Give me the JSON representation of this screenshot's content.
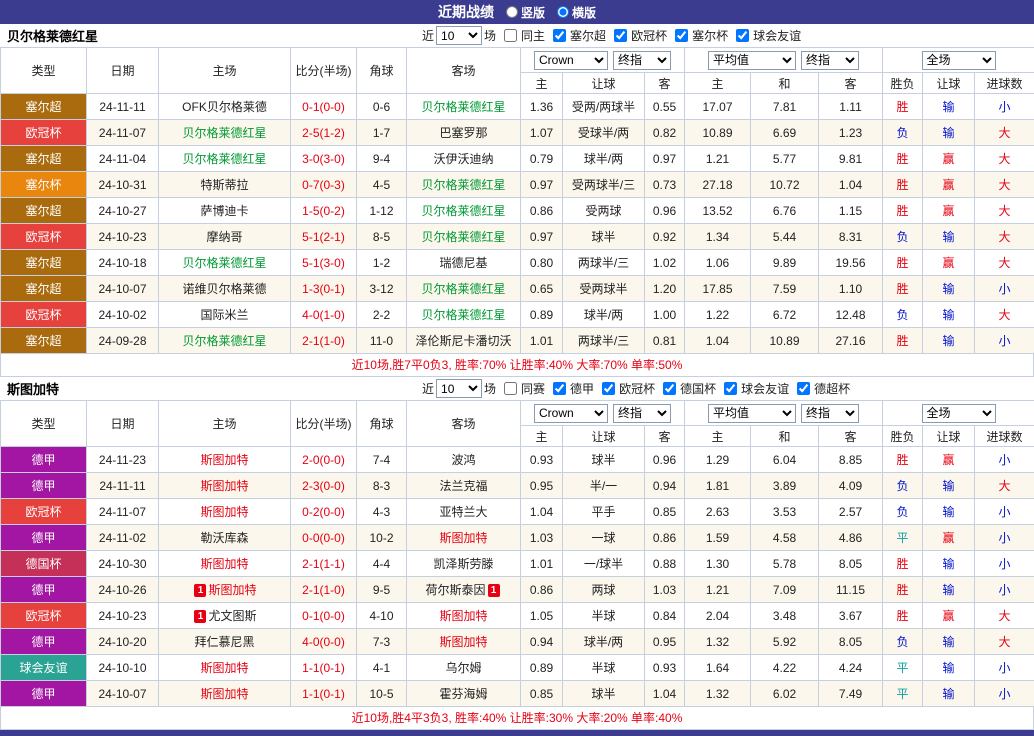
{
  "header": {
    "title": "近期战绩",
    "modes": [
      {
        "label": "竖版",
        "checked": false
      },
      {
        "label": "横版",
        "checked": true
      }
    ]
  },
  "colors": {
    "topbar_bg": "#3b3b8f",
    "league": {
      "塞尔超": "#aa6b0e",
      "欧冠杯": "#e6413d",
      "塞尔杯": "#e8860e",
      "德甲": "#a316a3",
      "德国杯": "#c43057",
      "球会友谊": "#2aa394"
    },
    "team": {
      "green": "#009933",
      "red": "#e60012",
      "black": "#222222"
    },
    "result": {
      "red": "#e60012",
      "blue": "#0010cc",
      "teal": "#0d9f9f"
    },
    "score": "#e60012",
    "summary": "#e60012"
  },
  "sections": [
    {
      "team": "贝尔格莱德红星",
      "filter": {
        "near_label": "近",
        "count": "10",
        "games_label": "场",
        "same_label": "同主",
        "same_checked": false,
        "leagues": [
          "塞尔超",
          "欧冠杯",
          "塞尔杯",
          "球会友谊"
        ]
      },
      "table_header": {
        "static": [
          "类型",
          "日期",
          "主场",
          "比分(半场)",
          "角球",
          "客场"
        ],
        "bookmaker": "Crown",
        "final_odds": "终指",
        "average": "平均值",
        "final_odds2": "终指",
        "fulltime": "全场",
        "sub": [
          "主",
          "让球",
          "客",
          "主",
          "和",
          "客",
          "胜负",
          "让球",
          "进球数"
        ]
      },
      "rows": [
        {
          "league": "塞尔超",
          "date": "24-11-11",
          "home": "OFK贝尔格莱德",
          "home_color": "black",
          "home_card": "",
          "score": "0-1(0-0)",
          "corner": "0-6",
          "away": "贝尔格莱德红星",
          "away_color": "green",
          "away_card": "",
          "odds": [
            "1.36",
            "受两/两球半",
            "0.55"
          ],
          "avg": [
            "17.07",
            "7.81",
            "1.11"
          ],
          "results": [
            [
              "胜",
              "red"
            ],
            [
              "输",
              "blue"
            ],
            [
              "小",
              "blue"
            ]
          ]
        },
        {
          "league": "欧冠杯",
          "date": "24-11-07",
          "home": "贝尔格莱德红星",
          "home_color": "green",
          "home_card": "",
          "score": "2-5(1-2)",
          "corner": "1-7",
          "away": "巴塞罗那",
          "away_color": "black",
          "away_card": "",
          "odds": [
            "1.07",
            "受球半/两",
            "0.82"
          ],
          "avg": [
            "10.89",
            "6.69",
            "1.23"
          ],
          "results": [
            [
              "负",
              "blue"
            ],
            [
              "输",
              "blue"
            ],
            [
              "大",
              "red"
            ]
          ]
        },
        {
          "league": "塞尔超",
          "date": "24-11-04",
          "home": "贝尔格莱德红星",
          "home_color": "green",
          "home_card": "",
          "score": "3-0(3-0)",
          "corner": "9-4",
          "away": "沃伊沃迪纳",
          "away_color": "black",
          "away_card": "",
          "odds": [
            "0.79",
            "球半/两",
            "0.97"
          ],
          "avg": [
            "1.21",
            "5.77",
            "9.81"
          ],
          "results": [
            [
              "胜",
              "red"
            ],
            [
              "赢",
              "red"
            ],
            [
              "大",
              "red"
            ]
          ]
        },
        {
          "league": "塞尔杯",
          "date": "24-10-31",
          "home": "特斯蒂拉",
          "home_color": "black",
          "home_card": "",
          "score": "0-7(0-3)",
          "corner": "4-5",
          "away": "贝尔格莱德红星",
          "away_color": "green",
          "away_card": "",
          "odds": [
            "0.97",
            "受两球半/三",
            "0.73"
          ],
          "avg": [
            "27.18",
            "10.72",
            "1.04"
          ],
          "results": [
            [
              "胜",
              "red"
            ],
            [
              "赢",
              "red"
            ],
            [
              "大",
              "red"
            ]
          ]
        },
        {
          "league": "塞尔超",
          "date": "24-10-27",
          "home": "萨博迪卡",
          "home_color": "black",
          "home_card": "",
          "score": "1-5(0-2)",
          "corner": "1-12",
          "away": "贝尔格莱德红星",
          "away_color": "green",
          "away_card": "",
          "odds": [
            "0.86",
            "受两球",
            "0.96"
          ],
          "avg": [
            "13.52",
            "6.76",
            "1.15"
          ],
          "results": [
            [
              "胜",
              "red"
            ],
            [
              "赢",
              "red"
            ],
            [
              "大",
              "red"
            ]
          ]
        },
        {
          "league": "欧冠杯",
          "date": "24-10-23",
          "home": "摩纳哥",
          "home_color": "black",
          "home_card": "",
          "score": "5-1(2-1)",
          "corner": "8-5",
          "away": "贝尔格莱德红星",
          "away_color": "green",
          "away_card": "",
          "odds": [
            "0.97",
            "球半",
            "0.92"
          ],
          "avg": [
            "1.34",
            "5.44",
            "8.31"
          ],
          "results": [
            [
              "负",
              "blue"
            ],
            [
              "输",
              "blue"
            ],
            [
              "大",
              "red"
            ]
          ]
        },
        {
          "league": "塞尔超",
          "date": "24-10-18",
          "home": "贝尔格莱德红星",
          "home_color": "green",
          "home_card": "",
          "score": "5-1(3-0)",
          "corner": "1-2",
          "away": "瑞德尼基",
          "away_color": "black",
          "away_card": "",
          "odds": [
            "0.80",
            "两球半/三",
            "1.02"
          ],
          "avg": [
            "1.06",
            "9.89",
            "19.56"
          ],
          "results": [
            [
              "胜",
              "red"
            ],
            [
              "赢",
              "red"
            ],
            [
              "大",
              "red"
            ]
          ]
        },
        {
          "league": "塞尔超",
          "date": "24-10-07",
          "home": "诺维贝尔格莱德",
          "home_color": "black",
          "home_card": "",
          "score": "1-3(0-1)",
          "corner": "3-12",
          "away": "贝尔格莱德红星",
          "away_color": "green",
          "away_card": "",
          "odds": [
            "0.65",
            "受两球半",
            "1.20"
          ],
          "avg": [
            "17.85",
            "7.59",
            "1.10"
          ],
          "results": [
            [
              "胜",
              "red"
            ],
            [
              "输",
              "blue"
            ],
            [
              "小",
              "blue"
            ]
          ]
        },
        {
          "league": "欧冠杯",
          "date": "24-10-02",
          "home": "国际米兰",
          "home_color": "black",
          "home_card": "",
          "score": "4-0(1-0)",
          "corner": "2-2",
          "away": "贝尔格莱德红星",
          "away_color": "green",
          "away_card": "",
          "odds": [
            "0.89",
            "球半/两",
            "1.00"
          ],
          "avg": [
            "1.22",
            "6.72",
            "12.48"
          ],
          "results": [
            [
              "负",
              "blue"
            ],
            [
              "输",
              "blue"
            ],
            [
              "大",
              "red"
            ]
          ]
        },
        {
          "league": "塞尔超",
          "date": "24-09-28",
          "home": "贝尔格莱德红星",
          "home_color": "green",
          "home_card": "",
          "score": "2-1(1-0)",
          "corner": "11-0",
          "away": "泽伦斯尼卡潘切沃",
          "away_color": "black",
          "away_card": "",
          "odds": [
            "1.01",
            "两球半/三",
            "0.81"
          ],
          "avg": [
            "1.04",
            "10.89",
            "27.16"
          ],
          "results": [
            [
              "胜",
              "red"
            ],
            [
              "输",
              "blue"
            ],
            [
              "小",
              "blue"
            ]
          ]
        }
      ],
      "summary": "近10场,胜7平0负3, 胜率:70% 让胜率:40% 大率:70% 单率:50%"
    },
    {
      "team": "斯图加特",
      "filter": {
        "near_label": "近",
        "count": "10",
        "games_label": "场",
        "same_label": "同赛",
        "same_checked": false,
        "leagues": [
          "德甲",
          "欧冠杯",
          "德国杯",
          "球会友谊",
          "德超杯"
        ]
      },
      "table_header": {
        "static": [
          "类型",
          "日期",
          "主场",
          "比分(半场)",
          "角球",
          "客场"
        ],
        "bookmaker": "Crown",
        "final_odds": "终指",
        "average": "平均值",
        "final_odds2": "终指",
        "fulltime": "全场",
        "sub": [
          "主",
          "让球",
          "客",
          "主",
          "和",
          "客",
          "胜负",
          "让球",
          "进球数"
        ]
      },
      "rows": [
        {
          "league": "德甲",
          "date": "24-11-23",
          "home": "斯图加特",
          "home_color": "red",
          "home_card": "",
          "score": "2-0(0-0)",
          "corner": "7-4",
          "away": "波鸿",
          "away_color": "black",
          "away_card": "",
          "odds": [
            "0.93",
            "球半",
            "0.96"
          ],
          "avg": [
            "1.29",
            "6.04",
            "8.85"
          ],
          "results": [
            [
              "胜",
              "red"
            ],
            [
              "赢",
              "red"
            ],
            [
              "小",
              "blue"
            ]
          ]
        },
        {
          "league": "德甲",
          "date": "24-11-11",
          "home": "斯图加特",
          "home_color": "red",
          "home_card": "",
          "score": "2-3(0-0)",
          "corner": "8-3",
          "away": "法兰克福",
          "away_color": "black",
          "away_card": "",
          "odds": [
            "0.95",
            "半/一",
            "0.94"
          ],
          "avg": [
            "1.81",
            "3.89",
            "4.09"
          ],
          "results": [
            [
              "负",
              "blue"
            ],
            [
              "输",
              "blue"
            ],
            [
              "大",
              "red"
            ]
          ]
        },
        {
          "league": "欧冠杯",
          "date": "24-11-07",
          "home": "斯图加特",
          "home_color": "red",
          "home_card": "",
          "score": "0-2(0-0)",
          "corner": "4-3",
          "away": "亚特兰大",
          "away_color": "black",
          "away_card": "",
          "odds": [
            "1.04",
            "平手",
            "0.85"
          ],
          "avg": [
            "2.63",
            "3.53",
            "2.57"
          ],
          "results": [
            [
              "负",
              "blue"
            ],
            [
              "输",
              "blue"
            ],
            [
              "小",
              "blue"
            ]
          ]
        },
        {
          "league": "德甲",
          "date": "24-11-02",
          "home": "勒沃库森",
          "home_color": "black",
          "home_card": "",
          "score": "0-0(0-0)",
          "corner": "10-2",
          "away": "斯图加特",
          "away_color": "red",
          "away_card": "",
          "odds": [
            "1.03",
            "一球",
            "0.86"
          ],
          "avg": [
            "1.59",
            "4.58",
            "4.86"
          ],
          "results": [
            [
              "平",
              "teal"
            ],
            [
              "赢",
              "red"
            ],
            [
              "小",
              "blue"
            ]
          ]
        },
        {
          "league": "德国杯",
          "date": "24-10-30",
          "home": "斯图加特",
          "home_color": "red",
          "home_card": "",
          "score": "2-1(1-1)",
          "corner": "4-4",
          "away": "凯泽斯劳滕",
          "away_color": "black",
          "away_card": "",
          "odds": [
            "1.01",
            "一/球半",
            "0.88"
          ],
          "avg": [
            "1.30",
            "5.78",
            "8.05"
          ],
          "results": [
            [
              "胜",
              "red"
            ],
            [
              "输",
              "blue"
            ],
            [
              "小",
              "blue"
            ]
          ]
        },
        {
          "league": "德甲",
          "date": "24-10-26",
          "home": "斯图加特",
          "home_color": "red",
          "home_card": "1",
          "score": "2-1(1-0)",
          "corner": "9-5",
          "away": "荷尔斯泰因",
          "away_color": "black",
          "away_card": "1",
          "odds": [
            "0.86",
            "两球",
            "1.03"
          ],
          "avg": [
            "1.21",
            "7.09",
            "11.15"
          ],
          "results": [
            [
              "胜",
              "red"
            ],
            [
              "输",
              "blue"
            ],
            [
              "小",
              "blue"
            ]
          ]
        },
        {
          "league": "欧冠杯",
          "date": "24-10-23",
          "home": "尤文图斯",
          "home_color": "black",
          "home_card": "1",
          "score": "0-1(0-0)",
          "corner": "4-10",
          "away": "斯图加特",
          "away_color": "red",
          "away_card": "",
          "odds": [
            "1.05",
            "半球",
            "0.84"
          ],
          "avg": [
            "2.04",
            "3.48",
            "3.67"
          ],
          "results": [
            [
              "胜",
              "red"
            ],
            [
              "赢",
              "red"
            ],
            [
              "大",
              "red"
            ]
          ]
        },
        {
          "league": "德甲",
          "date": "24-10-20",
          "home": "拜仁慕尼黑",
          "home_color": "black",
          "home_card": "",
          "score": "4-0(0-0)",
          "corner": "7-3",
          "away": "斯图加特",
          "away_color": "red",
          "away_card": "",
          "odds": [
            "0.94",
            "球半/两",
            "0.95"
          ],
          "avg": [
            "1.32",
            "5.92",
            "8.05"
          ],
          "results": [
            [
              "负",
              "blue"
            ],
            [
              "输",
              "blue"
            ],
            [
              "大",
              "red"
            ]
          ]
        },
        {
          "league": "球会友谊",
          "date": "24-10-10",
          "home": "斯图加特",
          "home_color": "red",
          "home_card": "",
          "score": "1-1(0-1)",
          "corner": "4-1",
          "away": "乌尔姆",
          "away_color": "black",
          "away_card": "",
          "odds": [
            "0.89",
            "半球",
            "0.93"
          ],
          "avg": [
            "1.64",
            "4.22",
            "4.24"
          ],
          "results": [
            [
              "平",
              "teal"
            ],
            [
              "输",
              "blue"
            ],
            [
              "小",
              "blue"
            ]
          ]
        },
        {
          "league": "德甲",
          "date": "24-10-07",
          "home": "斯图加特",
          "home_color": "red",
          "home_card": "",
          "score": "1-1(0-1)",
          "corner": "10-5",
          "away": "霍芬海姆",
          "away_color": "black",
          "away_card": "",
          "odds": [
            "0.85",
            "球半",
            "1.04"
          ],
          "avg": [
            "1.32",
            "6.02",
            "7.49"
          ],
          "results": [
            [
              "平",
              "teal"
            ],
            [
              "输",
              "blue"
            ],
            [
              "小",
              "blue"
            ]
          ]
        }
      ],
      "summary": "近10场,胜4平3负3, 胜率:40% 让胜率:30% 大率:20% 单率:40%"
    }
  ]
}
